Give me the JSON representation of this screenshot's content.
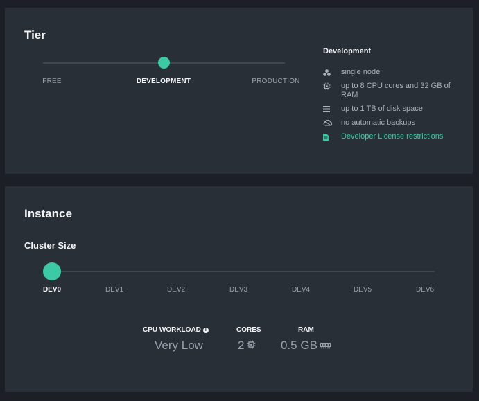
{
  "tier": {
    "title": "Tier",
    "options": [
      "FREE",
      "DEVELOPMENT",
      "PRODUCTION"
    ],
    "selected": "DEVELOPMENT",
    "details": {
      "title": "Development",
      "items": [
        {
          "icon": "nodes-icon",
          "text": "single node"
        },
        {
          "icon": "cpu-icon",
          "text": "up to 8 CPU cores and 32 GB of RAM"
        },
        {
          "icon": "disk-icon",
          "text": "up to 1 TB of disk space"
        },
        {
          "icon": "no-backup-icon",
          "text": "no automatic backups"
        },
        {
          "icon": "document-icon",
          "text": "Developer License restrictions",
          "link": true
        }
      ]
    }
  },
  "instance": {
    "title": "Instance",
    "cluster_size_label": "Cluster Size",
    "sizes": [
      "DEV0",
      "DEV1",
      "DEV2",
      "DEV3",
      "DEV4",
      "DEV5",
      "DEV6"
    ],
    "selected": "DEV0",
    "specs": {
      "cpu_workload": {
        "label": "CPU WORKLOAD",
        "value": "Very Low"
      },
      "cores": {
        "label": "CORES",
        "value": "2"
      },
      "ram": {
        "label": "RAM",
        "value": "0.5 GB"
      }
    }
  },
  "colors": {
    "accent": "#3cc9a5",
    "background": "#1c1f25",
    "panel": "#292f36"
  }
}
